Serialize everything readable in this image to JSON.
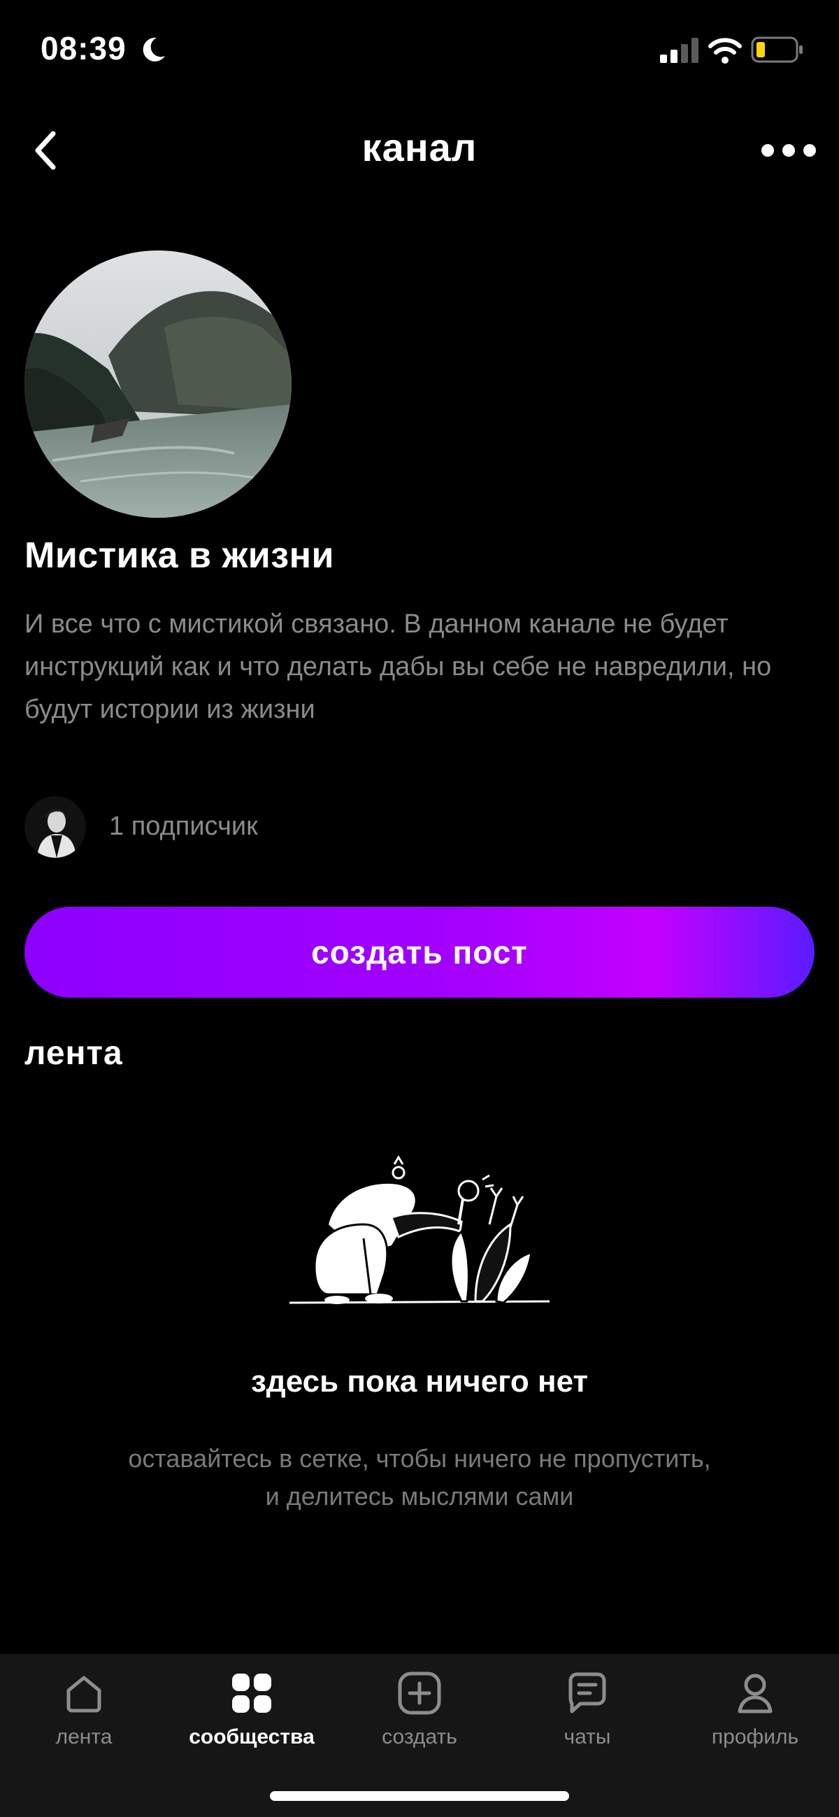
{
  "status": {
    "time": "08:39"
  },
  "nav": {
    "title": "канал"
  },
  "channel": {
    "name": "Мистика в жизни",
    "description": "И все что с мистикой связано. В данном канале не будет инструкций как и что делать дабы вы себе не навредили, но будут истории из жизни",
    "subscribers": "1 подписчик"
  },
  "actions": {
    "create_post": "создать пост"
  },
  "feed": {
    "heading": "лента",
    "empty_title": "здесь пока ничего нет",
    "empty_desc_line1": "оставайтесь в сетке, чтобы ничего не пропустить,",
    "empty_desc_line2": "и делитесь мыслями сами"
  },
  "tabbar": {
    "items": [
      {
        "label": "лента",
        "icon": "home-icon"
      },
      {
        "label": "сообщества",
        "icon": "grid-icon"
      },
      {
        "label": "создать",
        "icon": "plus-square-icon"
      },
      {
        "label": "чаты",
        "icon": "chat-icon"
      },
      {
        "label": "профиль",
        "icon": "user-icon"
      }
    ],
    "active": "сообщества"
  },
  "colors": {
    "accent_start": "#8d00ff",
    "accent_end": "#5a1cff",
    "muted_text": "#8a8a8a"
  }
}
